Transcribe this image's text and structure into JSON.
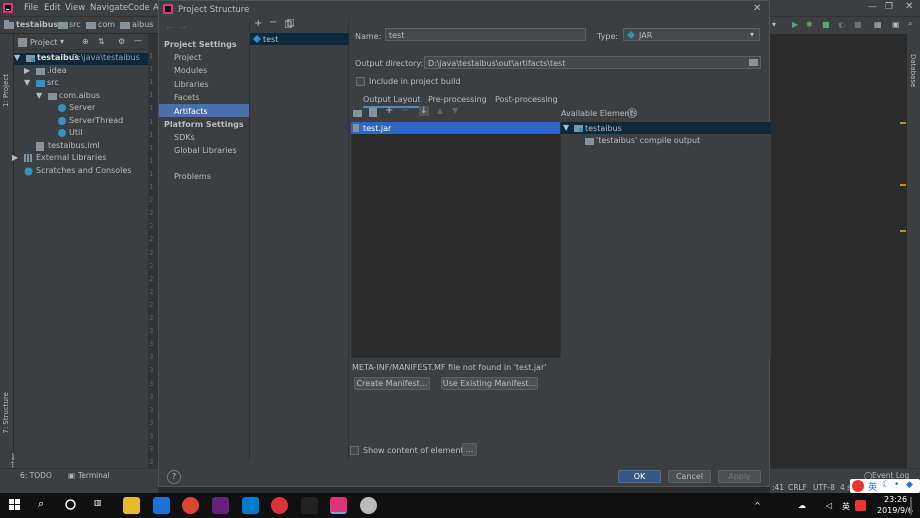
{
  "ide": {
    "menu": [
      "File",
      "Edit",
      "View",
      "Navigate",
      "Code",
      "A"
    ],
    "breadcrumb": [
      "testaibus",
      "src",
      "com",
      "aibus"
    ],
    "project_label": "Project",
    "tree": [
      {
        "label": "testaibus",
        "path": "D:\\java\\testaibus",
        "icon": "module-folder-icon"
      },
      {
        "label": ".idea",
        "icon": "folder-icon"
      },
      {
        "label": "src",
        "icon": "source-folder-icon"
      },
      {
        "label": "com.aibus",
        "icon": "package-icon"
      },
      {
        "label": "Server",
        "icon": "class-icon"
      },
      {
        "label": "ServerThread",
        "icon": "class-icon"
      },
      {
        "label": "Util",
        "icon": "class-icon"
      },
      {
        "label": "testaibus.iml",
        "icon": "iml-file-icon"
      },
      {
        "label": "External Libraries",
        "icon": "library-icon"
      },
      {
        "label": "Scratches and Consoles",
        "icon": "scratches-icon"
      }
    ],
    "gutter_numbers": [
      "1",
      "1",
      "1",
      "1",
      "1",
      "1",
      "1",
      "1",
      "1",
      "1",
      "1",
      "2",
      "2",
      "2",
      "2",
      "2",
      "2",
      "2",
      "2",
      "2",
      "2",
      "3",
      "3",
      "3",
      "3",
      "3",
      "3",
      "3",
      "3",
      "3",
      "3",
      "3"
    ],
    "left_tool_tabs": [
      "1: Project",
      "7: Structure",
      "2: Favorites"
    ],
    "right_tool_tabs": [
      "Database"
    ],
    "bottom_tabs": [
      "6: TODO",
      "Terminal"
    ],
    "status": {
      "pos": ":41",
      "line_sep": "CRLF",
      "encoding": "UTF-8",
      "indent": "4 s",
      "event_log": "Event Log"
    }
  },
  "dialog": {
    "title": "Project Structure",
    "project_settings_header": "Project Settings",
    "project_settings": [
      "Project",
      "Modules",
      "Libraries",
      "Facets",
      "Artifacts"
    ],
    "platform_settings_header": "Platform Settings",
    "platform_settings": [
      "SDKs",
      "Global Libraries"
    ],
    "problems": "Problems",
    "artifacts": [
      "test"
    ],
    "name_label": "Name:",
    "name_value": "test",
    "type_label": "Type:",
    "type_value": "JAR",
    "output_label": "Output directory:",
    "output_value": "D:\\java\\testaibus\\out\\artifacts\\test",
    "include_label": "Include in project build",
    "tabs": [
      "Output Layout",
      "Pre-processing",
      "Post-processing"
    ],
    "layout_items": [
      "test.jar"
    ],
    "available_label": "Available Elements",
    "available_tree": [
      "testaibus",
      "'testaibus' compile output"
    ],
    "manifest_warning": "META-INF/MANIFEST.MF file not found in 'test.jar'",
    "create_manifest": "Create Manifest...",
    "use_existing": "Use Existing Manifest...",
    "show_content": "Show content of elements",
    "ellipsis": "...",
    "help": "?",
    "ok": "OK",
    "cancel": "Cancel",
    "apply": "Apply"
  },
  "taskbar": {
    "time": "23:26",
    "date": "2019/9/6",
    "ime": "英",
    "lang_char": "英"
  },
  "colors": {
    "selection": "#4b6eaf",
    "ok_button": "#365880",
    "bg": "#3c3f41"
  }
}
